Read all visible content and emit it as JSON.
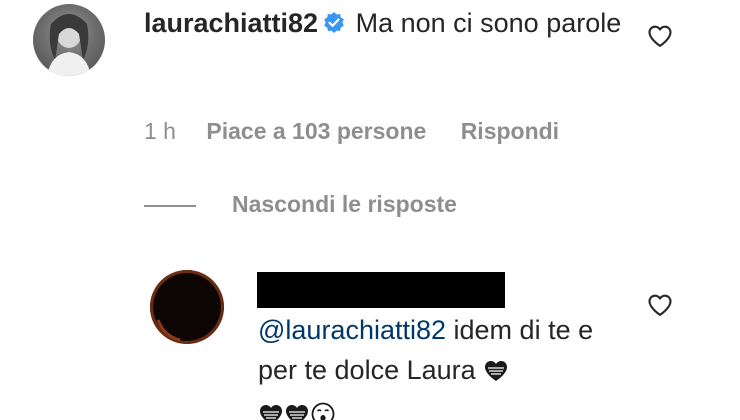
{
  "comment": {
    "username": "laurachiatti82",
    "verified": true,
    "text": "Ma non ci sono parole",
    "time": "1 h",
    "likes": "Piace a 103 persone",
    "reply_label": "Rispondi"
  },
  "replies_toggle": {
    "label": "Nascondi le risposte"
  },
  "reply": {
    "username_redacted": true,
    "mention": "@laurachiatti82",
    "text": "idem di te e per te dolce Laura",
    "emojis": [
      "black-heart-icon",
      "black-heart-icon",
      "black-heart-icon",
      "face-icon"
    ]
  },
  "colors": {
    "text": "#262626",
    "secondary": "#8e8e8e",
    "mention": "#00376b",
    "verified": "#3897f0"
  }
}
